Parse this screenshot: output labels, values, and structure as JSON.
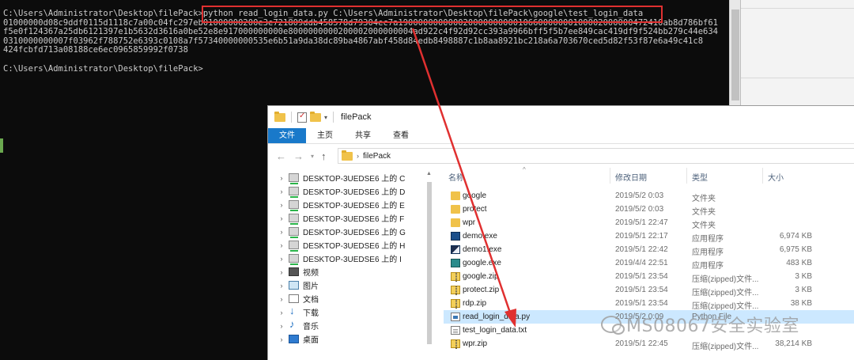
{
  "console": {
    "lines": [
      "C:\\Users\\Administrator\\Desktop\\filePack>python read_login_data.py C:\\Users\\Administrator\\Desktop\\filePack\\google\\test_login_data",
      "01000000d08c9ddf0115d1118c7a00c04fc297eb01000000200e3e721809ddb458578d79304ec7a19000000000002000000000010660000000100002000000472410ab8d786bf61",
      "f5e0f124367a25db6121397e1b5632d3616a0be52e8e917000000000e8000000000200002000000004ad922c4f92d92cc393a9966bff5f5b7ee849cac419df9f524bb279c44e634",
      "0310000000007f03962f788752e6393c0108a7f57340000000535e6b51a9da38dc89ba4867abf458d84edb8498887c1b8aa8921bc218a6a703670ced5d82f53f87e6a49c41c8",
      "424fcbfd713a08188ce6ec0965859992f0738",
      "",
      "C:\\Users\\Administrator\\Desktop\\filePack>"
    ],
    "highlight_color": "#e03030"
  },
  "explorer": {
    "title": "filePack",
    "ribbon_tabs": [
      "文件",
      "主页",
      "共享",
      "查看"
    ],
    "address": {
      "breadcrumb": "filePack"
    },
    "nav_items": [
      {
        "label": "DESKTOP-3UEDSE6 上的 C",
        "icon": "drive-icon"
      },
      {
        "label": "DESKTOP-3UEDSE6 上的 D",
        "icon": "drive-icon"
      },
      {
        "label": "DESKTOP-3UEDSE6 上的 E",
        "icon": "drive-icon"
      },
      {
        "label": "DESKTOP-3UEDSE6 上的 F",
        "icon": "drive-icon"
      },
      {
        "label": "DESKTOP-3UEDSE6 上的 G",
        "icon": "drive-icon"
      },
      {
        "label": "DESKTOP-3UEDSE6 上的 H",
        "icon": "drive-icon"
      },
      {
        "label": "DESKTOP-3UEDSE6 上的 I",
        "icon": "drive-icon"
      },
      {
        "label": "视频",
        "icon": "video-icon"
      },
      {
        "label": "图片",
        "icon": "pictures-icon"
      },
      {
        "label": "文档",
        "icon": "documents-icon"
      },
      {
        "label": "下载",
        "icon": "downloads-icon"
      },
      {
        "label": "音乐",
        "icon": "music-icon"
      },
      {
        "label": "桌面",
        "icon": "desktop-icon"
      }
    ],
    "columns": {
      "name": "名称",
      "date": "修改日期",
      "type": "类型",
      "size": "大小"
    },
    "files": [
      {
        "name": "google",
        "date": "2019/5/2 0:03",
        "type": "文件夹",
        "size": "",
        "icon": "folder-icon"
      },
      {
        "name": "protect",
        "date": "2019/5/2 0:03",
        "type": "文件夹",
        "size": "",
        "icon": "folder-icon"
      },
      {
        "name": "wpr",
        "date": "2019/5/1 22:47",
        "type": "文件夹",
        "size": "",
        "icon": "folder-icon"
      },
      {
        "name": "demo.exe",
        "date": "2019/5/1 22:17",
        "type": "应用程序",
        "size": "6,974 KB",
        "icon": "exe-icon"
      },
      {
        "name": "demo1.exe",
        "date": "2019/5/1 22:42",
        "type": "应用程序",
        "size": "6,975 KB",
        "icon": "exe-icon"
      },
      {
        "name": "google.exe",
        "date": "2019/4/4 22:51",
        "type": "应用程序",
        "size": "483 KB",
        "icon": "exe-icon"
      },
      {
        "name": "google.zip",
        "date": "2019/5/1 23:54",
        "type": "压缩(zipped)文件...",
        "size": "3 KB",
        "icon": "zip-icon"
      },
      {
        "name": "protect.zip",
        "date": "2019/5/1 23:54",
        "type": "压缩(zipped)文件...",
        "size": "3 KB",
        "icon": "zip-icon"
      },
      {
        "name": "rdp.zip",
        "date": "2019/5/1 23:54",
        "type": "压缩(zipped)文件...",
        "size": "38 KB",
        "icon": "zip-icon"
      },
      {
        "name": "read_login_data.py",
        "date": "2019/5/2 0:09",
        "type": "Python File",
        "size": "",
        "icon": "python-file-icon",
        "selected": true
      },
      {
        "name": "test_login_data.txt",
        "date": "",
        "type": "",
        "size": "",
        "icon": "text-file-icon"
      },
      {
        "name": "wpr.zip",
        "date": "2019/5/1 22:45",
        "type": "压缩(zipped)文件...",
        "size": "38,214 KB",
        "icon": "zip-icon"
      }
    ],
    "selection_color": "#cce8ff",
    "file_tab_color": "#1979ca"
  },
  "annotation": {
    "arrow_color": "#e03030"
  },
  "watermark": {
    "text": "MS08067安全实验室"
  }
}
